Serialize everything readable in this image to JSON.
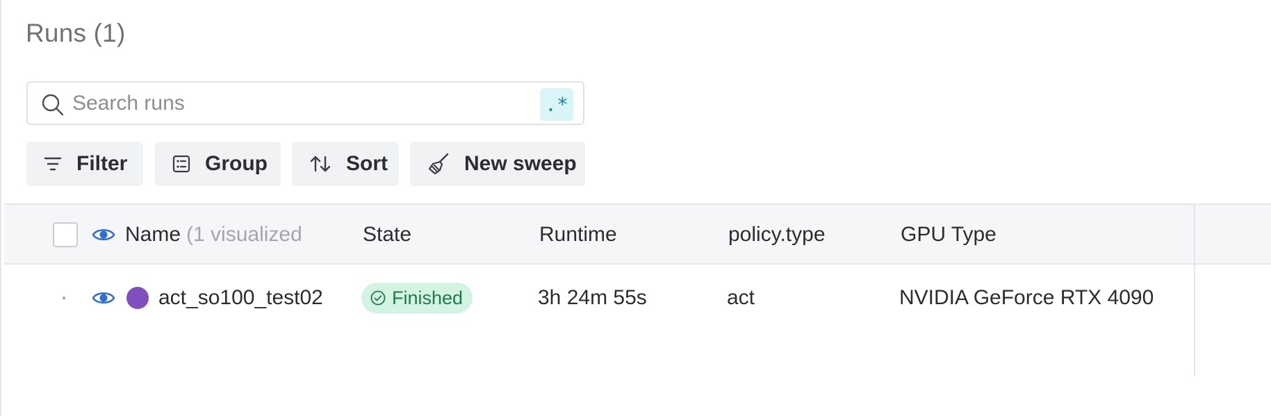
{
  "page": {
    "title": "Runs (1)"
  },
  "search": {
    "placeholder": "Search runs",
    "value": "",
    "regex_label": ".*"
  },
  "toolbar": {
    "filter_label": "Filter",
    "group_label": "Group",
    "sort_label": "Sort",
    "sweep_label": "New sweep"
  },
  "table": {
    "columns": {
      "name": "Name",
      "name_note": "(1 visualized",
      "state": "State",
      "runtime": "Runtime",
      "policy_type": "policy.type",
      "gpu_type": "GPU Type"
    },
    "rows": [
      {
        "name": "act_so100_test02",
        "color": "#7e4fbd",
        "state": "Finished",
        "runtime": "3h 24m 55s",
        "policy_type": "act",
        "gpu_type": "NVIDIA GeForce RTX 4090"
      }
    ]
  },
  "colors": {
    "eye_icon": "#2f6fd0",
    "finished_bg": "#d3f4e2",
    "finished_text": "#1f7a4a",
    "regex_bg": "#d9f5f8",
    "regex_text": "#1a8a99"
  },
  "icons": [
    "search-icon",
    "filter-icon",
    "group-icon",
    "sort-icon",
    "sweep-icon",
    "eye-icon",
    "check-circle-icon"
  ]
}
